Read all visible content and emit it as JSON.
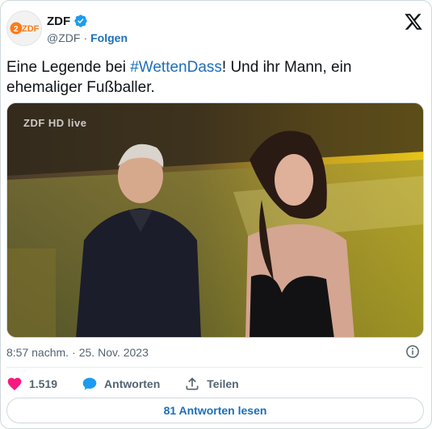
{
  "author": {
    "name": "ZDF",
    "handle": "@ZDF",
    "separator": "·",
    "follow_label": "Folgen",
    "avatar_text": "ZDF"
  },
  "tweet": {
    "text_before": "Eine Legende bei ",
    "hashtag": "#WettenDass",
    "text_after": "! Und ihr Mann, ein ehemaliger Fußballer."
  },
  "media": {
    "broadcast_bug": "ZDF HD live"
  },
  "meta": {
    "time": "8:57 nachm.",
    "separator": "·",
    "date": "25. Nov. 2023"
  },
  "actions": {
    "like_count": "1.519",
    "reply_label": "Antworten",
    "share_label": "Teilen"
  },
  "footer": {
    "read_replies_label": "81 Antworten lesen"
  },
  "colors": {
    "link": "#1d6fb8",
    "like": "#f91880",
    "reply": "#1d9bf0",
    "verified": "#1d9bf0",
    "zdf_orange": "#fa7d19"
  },
  "icons": {
    "header": "x-logo-icon",
    "badge": "verified-badge-icon",
    "info": "info-icon",
    "like": "heart-icon",
    "reply": "speech-bubble-icon",
    "share": "share-upload-icon"
  }
}
